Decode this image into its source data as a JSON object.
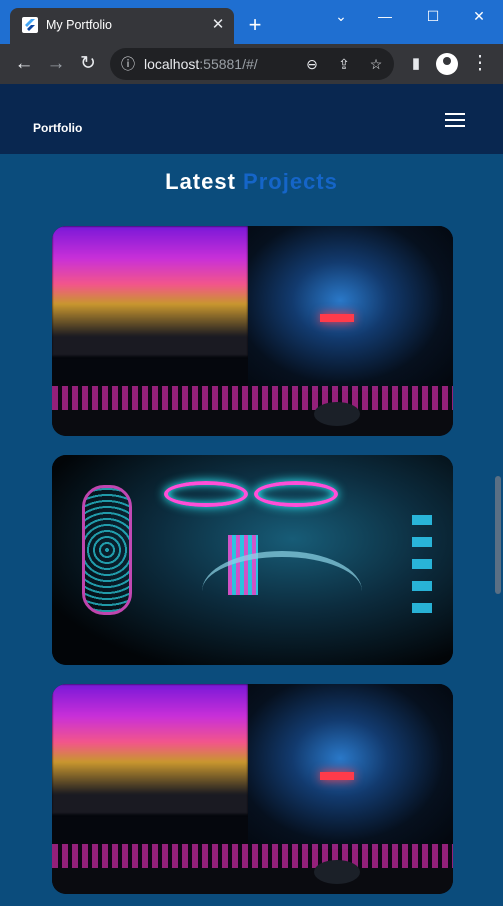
{
  "browser": {
    "tab_title": "My Portfolio",
    "tab_close": "✕",
    "new_tab": "+",
    "url_host": "localhost",
    "url_rest": ":55881/#/",
    "icons": {
      "back": "←",
      "forward": "→",
      "reload": "↻",
      "info": "ⓘ",
      "zoom": "⊖",
      "share": "⇪",
      "star": "☆",
      "sidepanel": "▮",
      "menu": "⋮",
      "minimize": "—",
      "maximize": "☐",
      "close": "✕",
      "chevron": "⌄"
    }
  },
  "app": {
    "brand": "Portfolio",
    "section_title_white": "Latest",
    "section_title_blue": "Projects"
  },
  "colors": {
    "titlebar": "#1f6fd1",
    "appbar": "#092750",
    "page_bg": "#0b4c7c",
    "accent_blue": "#1565c8"
  },
  "projects": [
    {
      "image": "gaming-setup-neon-pc-1"
    },
    {
      "image": "liquid-cooled-pc-neon"
    },
    {
      "image": "gaming-setup-neon-pc-2"
    }
  ]
}
